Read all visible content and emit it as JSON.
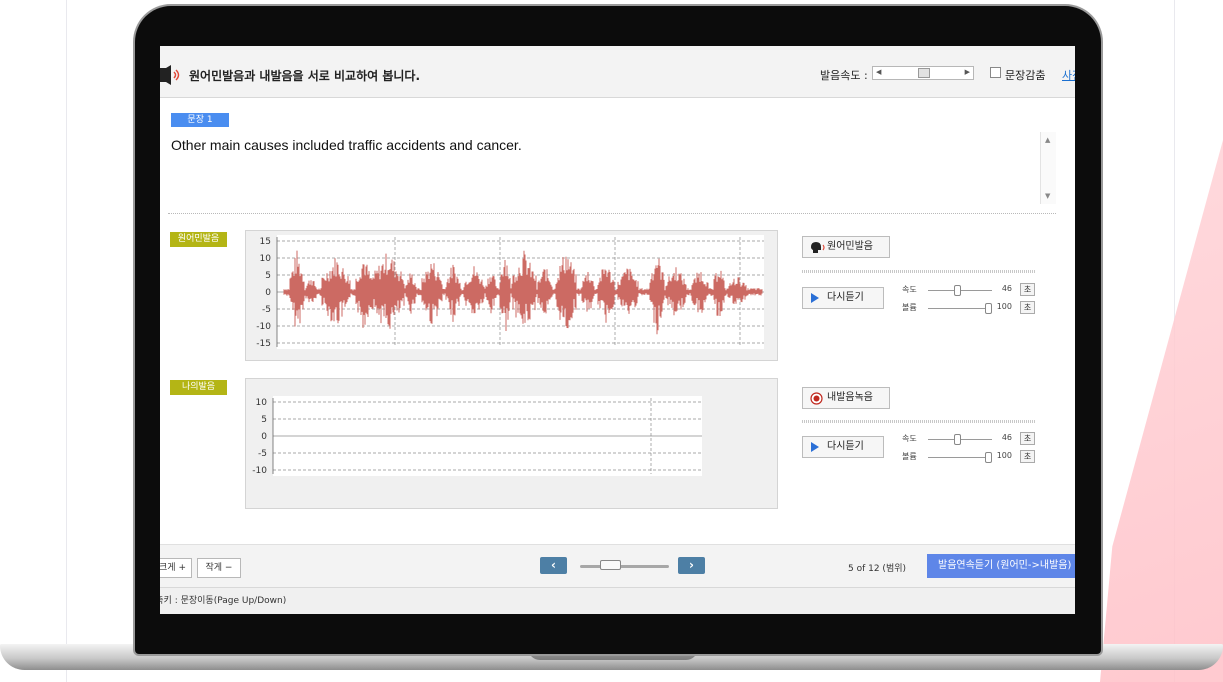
{
  "header": {
    "title": "원어민발음과 내발음을 서로 비교하여 봅니다.",
    "speed_label": "발음속도 :",
    "checkbox_label": "문장감춤",
    "link_text": "사전"
  },
  "sentence": {
    "badge": "문장 1",
    "text": "Other main causes included traffic accidents and cancer."
  },
  "native": {
    "tag": "원어민발음",
    "button_label": "원어민발음",
    "y_ticks": [
      "15",
      "10",
      "5",
      "0",
      "-5",
      "-10",
      "-15"
    ],
    "replay_label": "다시듣기",
    "speed_label": "속도",
    "speed_value": "46",
    "volume_label": "볼륨",
    "volume_value": "100",
    "unit_button": "초",
    "speed_level": 0.45,
    "volume_level": 1.0,
    "wave_color": "#cc6a63"
  },
  "mine": {
    "tag": "나의발음",
    "button_label": "내발음녹음",
    "y_ticks": [
      "10",
      "5",
      "0",
      "-5",
      "-10"
    ],
    "replay_label": "다시듣기",
    "speed_label": "속도",
    "speed_value": "46",
    "volume_label": "볼륨",
    "volume_value": "100",
    "unit_button": "초",
    "speed_level": 0.45,
    "volume_level": 1.0
  },
  "footer": {
    "bigger": "크게 +",
    "smaller": "작게 −",
    "prev_icon": "chevron-left-icon",
    "next_icon": "chevron-right-icon",
    "page_info": "5 of 12 (범위)",
    "continuous_button": "발음연속듣기 (원어민->내발음)",
    "progress_level": 0.3
  },
  "status": {
    "text": "단축키 : 문장이동(Page Up/Down)"
  },
  "colors": {
    "accent": "#5e86e8",
    "tag": "#b4b515",
    "badge": "#4a8df0",
    "nav": "#4d7fa5"
  }
}
